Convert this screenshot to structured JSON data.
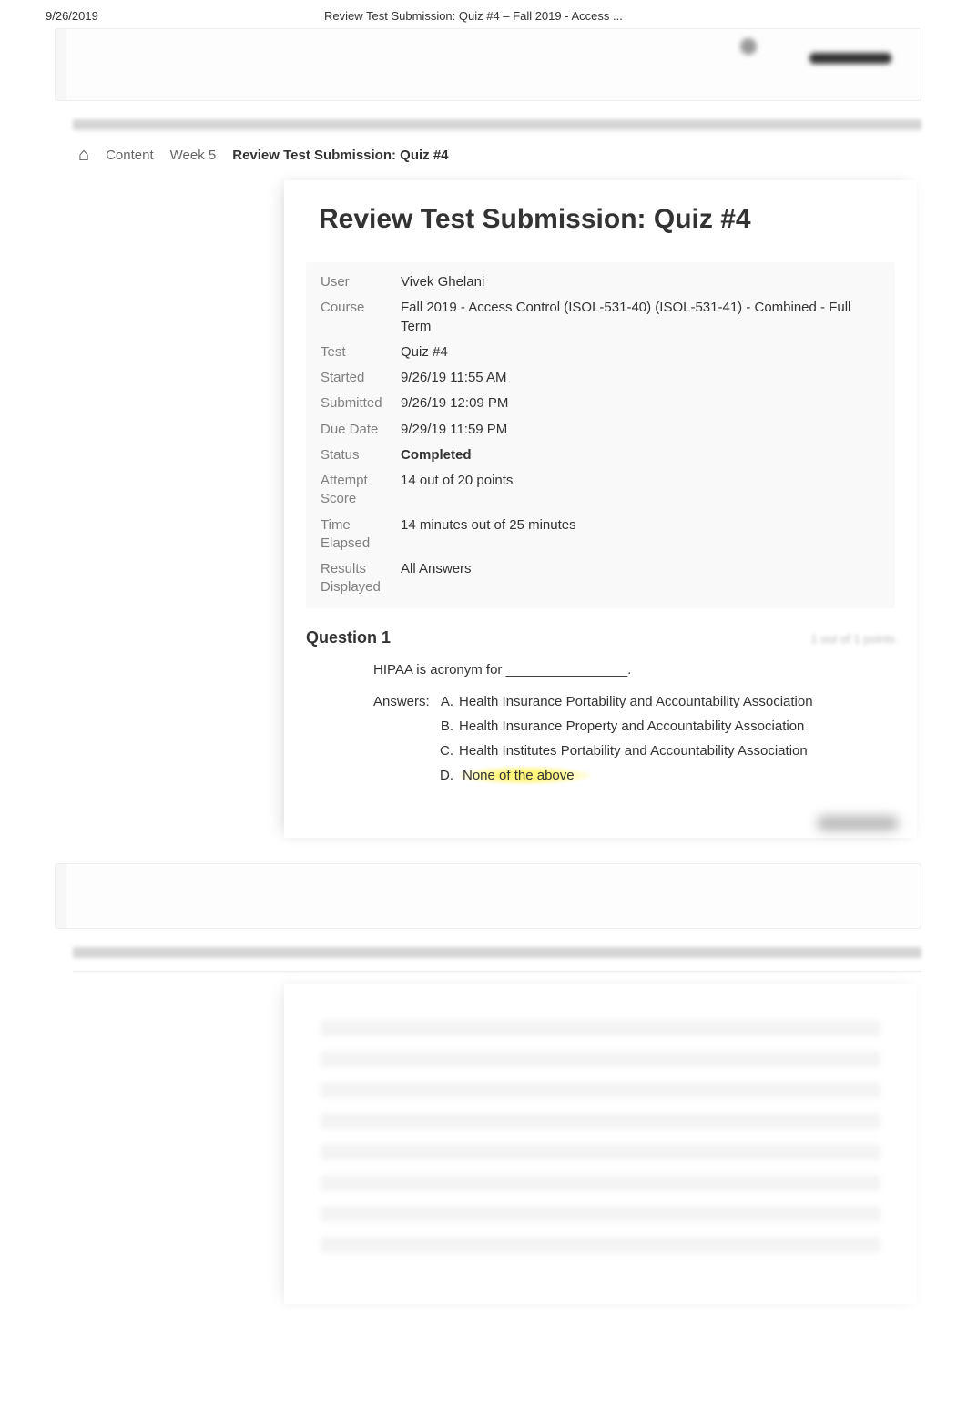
{
  "print": {
    "date": "9/26/2019",
    "title": "Review Test Submission: Quiz #4 – Fall 2019 - Access ..."
  },
  "breadcrumb": {
    "content": "Content",
    "week": "Week 5",
    "current": "Review Test Submission: Quiz #4"
  },
  "page": {
    "title": "Review Test Submission: Quiz #4"
  },
  "info": {
    "user_label": "User",
    "user_value": "Vivek Ghelani",
    "course_label": "Course",
    "course_value": "Fall 2019 - Access Control (ISOL-531-40) (ISOL-531-41) - Combined - Full Term",
    "test_label": "Test",
    "test_value": "Quiz #4",
    "started_label": "Started",
    "started_value": "9/26/19 11:55 AM",
    "submitted_label": "Submitted",
    "submitted_value": "9/26/19 12:09 PM",
    "due_label": "Due Date",
    "due_value": "9/29/19 11:59 PM",
    "status_label": "Status",
    "status_value": "Completed",
    "score_label": "Attempt Score",
    "score_value": "14 out of 20 points",
    "time_label": "Time Elapsed",
    "time_value": "14 minutes out of 25 minutes",
    "results_label": "Results Displayed",
    "results_value": "All Answers"
  },
  "question1": {
    "heading": "Question 1",
    "points": "1 out of 1 points",
    "stem": "HIPAA is acronym for ________________.",
    "answers_label": "Answers:",
    "a_letter": "A.",
    "a_text": "Health Insurance Portability and Accountability Association",
    "b_letter": "B.",
    "b_text": "Health Insurance Property and Accountability Association",
    "c_letter": "C.",
    "c_text": "Health Institutes Portability and Accountability Association",
    "d_letter": "D.",
    "d_text": "None of the above"
  }
}
